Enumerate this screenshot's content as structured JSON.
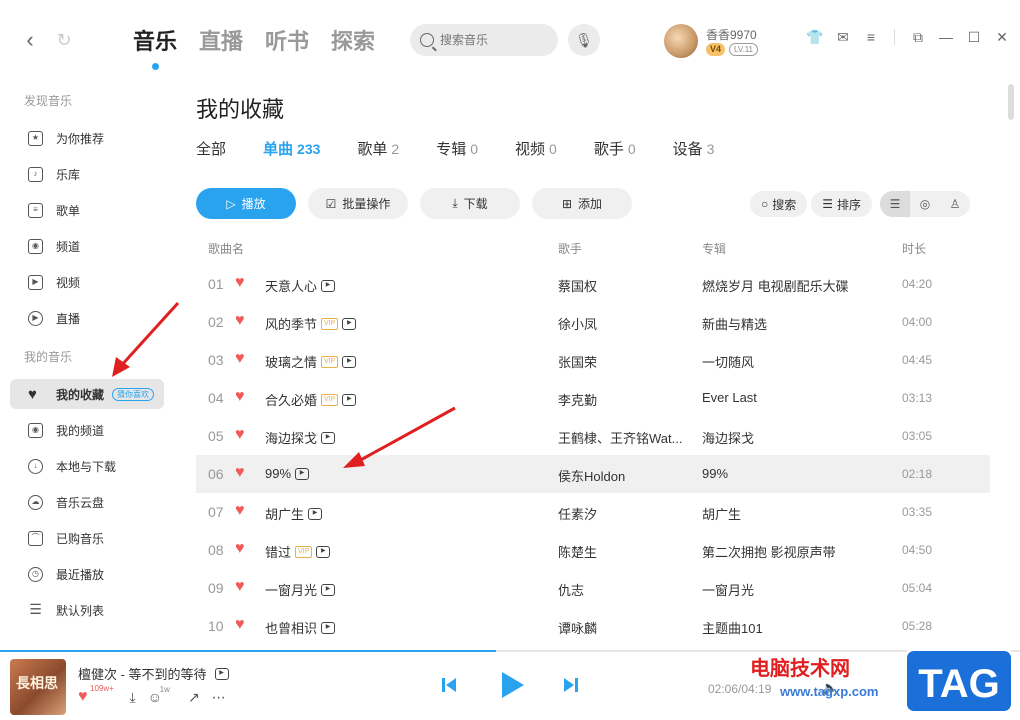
{
  "topbar": {
    "main_tabs": [
      "音乐",
      "直播",
      "听书",
      "探索"
    ],
    "search_placeholder": "搜索音乐",
    "user": {
      "name": "香香9970",
      "vip": "V4",
      "level": "LV.11"
    }
  },
  "sidebar": {
    "section_discover": "发现音乐",
    "discover_items": [
      "为你推荐",
      "乐库",
      "歌单",
      "频道",
      "视频",
      "直播"
    ],
    "section_mine": "我的音乐",
    "mine_items": [
      "我的收藏",
      "我的频道",
      "本地与下载",
      "音乐云盘",
      "已购音乐",
      "最近播放",
      "默认列表"
    ],
    "favorite_tag": "猜你喜欢"
  },
  "main": {
    "title": "我的收藏",
    "tabs": [
      {
        "label": "全部",
        "count": ""
      },
      {
        "label": "单曲",
        "count": "233"
      },
      {
        "label": "歌单",
        "count": "2"
      },
      {
        "label": "专辑",
        "count": "0"
      },
      {
        "label": "视频",
        "count": "0"
      },
      {
        "label": "歌手",
        "count": "0"
      },
      {
        "label": "设备",
        "count": "3"
      }
    ],
    "toolbar": {
      "play": "播放",
      "batch": "批量操作",
      "download": "下载",
      "add": "添加",
      "search": "搜索",
      "sort": "排序"
    },
    "columns": {
      "title": "歌曲名",
      "singer": "歌手",
      "album": "专辑",
      "duration": "时长"
    },
    "songs": [
      {
        "num": "01",
        "title": "天意人心",
        "vip": "",
        "singer": "蔡国权",
        "album": "燃烧岁月 电视剧配乐大碟",
        "duration": "04:20"
      },
      {
        "num": "02",
        "title": "风的季节",
        "vip": "VIP",
        "singer": "徐小凤",
        "album": "新曲与精选",
        "duration": "04:00"
      },
      {
        "num": "03",
        "title": "玻璃之情",
        "vip": "VIP",
        "singer": "张国荣",
        "album": "一切随风",
        "duration": "04:45"
      },
      {
        "num": "04",
        "title": "合久必婚",
        "vip": "VIP",
        "singer": "李克勤",
        "album": "Ever Last",
        "duration": "03:13"
      },
      {
        "num": "05",
        "title": "海边探戈",
        "vip": "",
        "singer": "王鹤棣、王齐铭Wat...",
        "album": "海边探戈",
        "duration": "03:05"
      },
      {
        "num": "06",
        "title": "99%",
        "vip": "",
        "singer": "侯东Holdon",
        "album": "99%",
        "duration": "02:18"
      },
      {
        "num": "07",
        "title": "胡广生",
        "vip": "",
        "singer": "任素汐",
        "album": "胡广生",
        "duration": "03:35"
      },
      {
        "num": "08",
        "title": "错过",
        "vip": "VIP",
        "singer": "陈楚生",
        "album": "第二次拥抱 影视原声带",
        "duration": "04:50"
      },
      {
        "num": "09",
        "title": "一窗月光",
        "vip": "",
        "singer": "仇志",
        "album": "一窗月光",
        "duration": "05:04"
      },
      {
        "num": "10",
        "title": "也曾相识",
        "vip": "",
        "singer": "谭咏麟",
        "album": "主题曲101",
        "duration": "05:28"
      }
    ],
    "highlighted_row": "06"
  },
  "player": {
    "now_playing": "檀健次 - 等不到的等待",
    "cover_text": "長相思",
    "like_count": "109w+",
    "comment_count": "1w",
    "time": "02:06/04:19",
    "progress": 0.486
  },
  "watermark": {
    "text": "电脑技术网",
    "url": "www.tagxp.com",
    "tag": "TAG"
  },
  "colors": {
    "accent": "#2aa3ef",
    "heart": "#f05a5a",
    "vip": "#e8b04a",
    "annotation": "#e02020"
  }
}
